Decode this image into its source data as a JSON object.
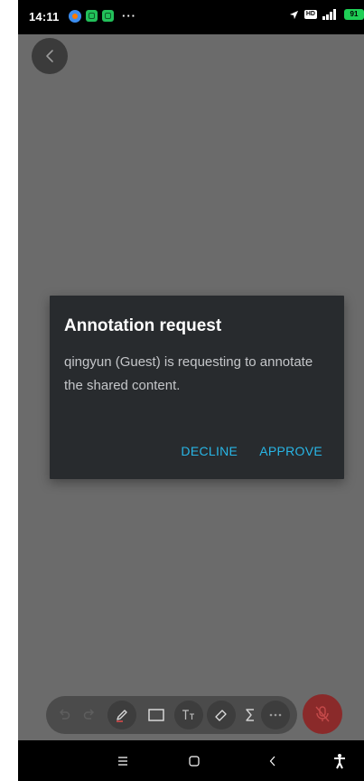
{
  "status_bar": {
    "time": "14:11",
    "battery": "91",
    "icons": [
      "messenger-icon",
      "app-icon",
      "app-icon",
      "more-dots",
      "location-arrow-icon",
      "hd-icon",
      "signal-icon",
      "battery-icon"
    ]
  },
  "dialog": {
    "title": "Annotation request",
    "message": "qingyun (Guest) is requesting to annotate the shared content.",
    "decline_label": "DECLINE",
    "approve_label": "APPROVE"
  },
  "toolbar": {
    "tools": [
      "undo-icon",
      "redo-icon",
      "pen-icon",
      "rectangle-icon",
      "text-icon",
      "eraser-icon",
      "sum-icon",
      "more-icon"
    ]
  },
  "colors": {
    "accent": "#28b6e6",
    "dialog_bg": "#282b2e",
    "screen_bg": "#6b6b6b",
    "mic_muted": "#8a2a2a"
  }
}
